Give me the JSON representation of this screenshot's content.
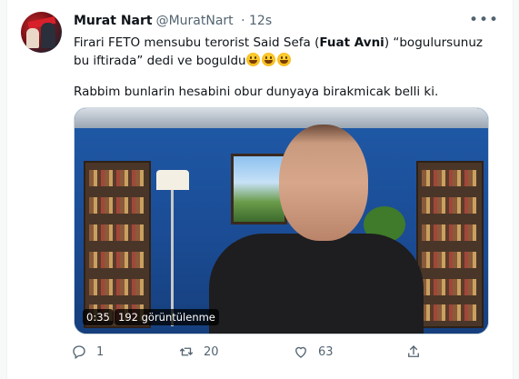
{
  "tweet": {
    "author_name": "Murat Nart",
    "author_handle": "@MuratNart",
    "time": "· 12s",
    "more_icon": "ellipsis-icon",
    "text_part1": "Firari FETO mensubu terorist Said Sefa (",
    "text_bold": "Fuat Avni",
    "text_part2": ")  “bogulursunuz bu iftirada” dedi ve boguldu",
    "emojis": [
      "grinning-face",
      "grinning-face",
      "grinning-face"
    ],
    "text_line2": "Rabbim bunlarin hesabini obur dunyaya birakmicak belli ki."
  },
  "video": {
    "duration": "0:35",
    "views": "192 görüntülenme"
  },
  "actions": {
    "reply": {
      "icon": "reply-icon",
      "count": "1"
    },
    "retweet": {
      "icon": "retweet-icon",
      "count": "20"
    },
    "like": {
      "icon": "heart-icon",
      "count": "63"
    },
    "share": {
      "icon": "share-icon"
    }
  }
}
